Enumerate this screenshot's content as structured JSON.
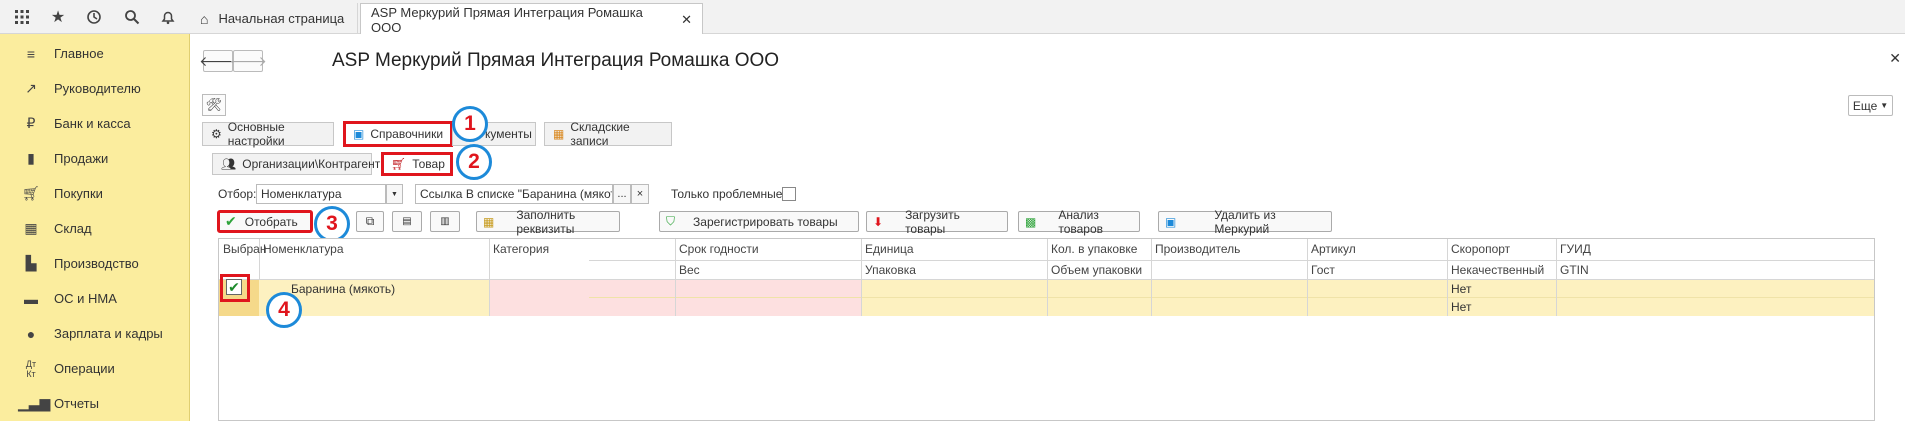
{
  "topbar": {
    "icons": [
      "apps-grid-icon",
      "star-icon",
      "history-icon",
      "search-icon",
      "bell-icon"
    ],
    "home_tab": "Начальная страница",
    "active_tab": "ASP Меркурий Прямая Интеграция Ромашка ООО"
  },
  "sidebar": {
    "items": [
      {
        "label": "Главное",
        "icon": "menu-icon"
      },
      {
        "label": "Руководителю",
        "icon": "trend-icon"
      },
      {
        "label": "Банк и касса",
        "icon": "ruble-icon"
      },
      {
        "label": "Продажи",
        "icon": "bag-icon"
      },
      {
        "label": "Покупки",
        "icon": "cart-icon"
      },
      {
        "label": "Склад",
        "icon": "warehouse-icon"
      },
      {
        "label": "Производство",
        "icon": "factory-icon"
      },
      {
        "label": "ОС и НМА",
        "icon": "truck-icon"
      },
      {
        "label": "Зарплата и кадры",
        "icon": "person-icon"
      },
      {
        "label": "Операции",
        "icon": "dt-kt-icon"
      },
      {
        "label": "Отчеты",
        "icon": "chart-icon"
      }
    ]
  },
  "main": {
    "title": "ASP Меркурий Прямая Интеграция Ромашка ООО",
    "more_label": "Еще",
    "tabs": [
      {
        "label": "Основные настройки"
      },
      {
        "label": "Справочники"
      },
      {
        "label": "кументы"
      },
      {
        "label": "Складские записи"
      }
    ],
    "subtabs": [
      {
        "label": "Организации\\Контрагенты"
      },
      {
        "label": "Товар"
      }
    ],
    "filter": {
      "label": "Отбор:",
      "field_value": "Номенклатура",
      "condition_value": "Ссылка В списке \"Баранина (мякоть)\"",
      "ellipsis": "...",
      "clear": "×",
      "only_problem_label": "Только проблемные:"
    },
    "toolbar": {
      "select": "Отобрать",
      "fill": "Заполнить реквизиты",
      "register": "Зарегистрировать товары",
      "load": "Загрузить товары",
      "analyze": "Анализ товаров",
      "delete": "Удалить из Меркурий"
    },
    "badges": [
      "1",
      "2",
      "3",
      "4"
    ],
    "grid": {
      "header_top": [
        "Выбран",
        "Номенклатура",
        "Категория",
        "Срок годности",
        "Единица",
        "Кол. в упаковке",
        "Производитель",
        "Артикул",
        "Скоропорт",
        "ГУИД"
      ],
      "header_bottom": [
        "",
        "",
        "",
        "Вес",
        "Упаковка",
        "Объем упаковки",
        "",
        "Гост",
        "Некачественный",
        "GTIN"
      ],
      "row": {
        "checked": true,
        "nomenclature": "Баранина (мякоть)",
        "perishable": "Нет",
        "poor_quality": "Нет"
      }
    }
  },
  "colors": {
    "sidebar": "#fbed9e",
    "row_highlight": "#fdf1c0",
    "row_pink": "#fde0e0",
    "annotation_red": "#e0151d",
    "annotation_blue": "#1d8ad9"
  }
}
